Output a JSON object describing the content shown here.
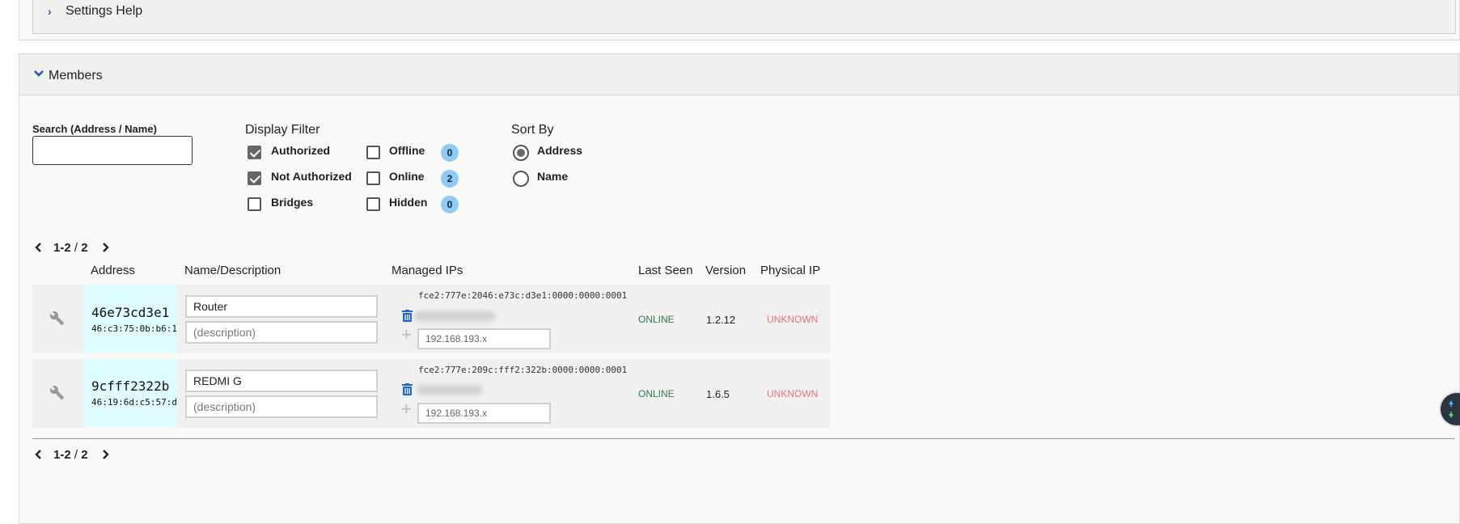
{
  "settings_help": {
    "title": "Settings Help"
  },
  "members": {
    "title": "Members",
    "search": {
      "label": "Search (Address / Name)",
      "value": ""
    },
    "display_filter": {
      "label": "Display Filter",
      "left_options": [
        {
          "label": "Authorized",
          "checked": true
        },
        {
          "label": "Not Authorized",
          "checked": true
        },
        {
          "label": "Bridges",
          "checked": false
        }
      ],
      "right_options": [
        {
          "label": "Offline",
          "checked": false,
          "count": "0"
        },
        {
          "label": "Online",
          "checked": false,
          "count": "2"
        },
        {
          "label": "Hidden",
          "checked": false,
          "count": "0"
        }
      ]
    },
    "sort_by": {
      "label": "Sort By",
      "options": [
        {
          "label": "Address",
          "selected": true
        },
        {
          "label": "Name",
          "selected": false
        }
      ]
    },
    "pager": {
      "range": "1-2",
      "separator": " / ",
      "total": "2"
    },
    "columns": {
      "address": "Address",
      "name": "Name/Description",
      "managed_ips": "Managed IPs",
      "last_seen": "Last Seen",
      "version": "Version",
      "physical_ip": "Physical IP"
    },
    "rows": [
      {
        "address": "46e73cd3e1",
        "mac": "46:c3:75:0b:b6:1",
        "name": "Router",
        "description_placeholder": "(description)",
        "ipv6": "fce2:777e:2046:e73c:d3e1:0000:0000:0001",
        "ip_placeholder": "192.168.193.x",
        "last_seen": "ONLINE",
        "version": "1.2.12",
        "physical_ip": "UNKNOWN"
      },
      {
        "address": "9cfff2322b",
        "mac": "46:19:6d:c5:57:d",
        "name": "REDMI G",
        "description_placeholder": "(description)",
        "ipv6": "fce2:777e:209c:fff2:322b:0000:0000:0001",
        "ip_placeholder": "192.168.193.x",
        "last_seen": "ONLINE",
        "version": "1.6.5",
        "physical_ip": "UNKNOWN"
      }
    ]
  },
  "icons": {
    "chevron_right": "chevron-right-icon",
    "chevron_down": "chevron-down-icon",
    "wrench": "wrench-icon",
    "trash": "trash-icon",
    "plus": "plus-icon"
  },
  "colors": {
    "accent_blue": "#1f5fa8",
    "badge_blue": "#8ec8f5",
    "address_cell": "#dffcff",
    "online_green": "#2e7d4f",
    "unknown_red": "#e57373"
  }
}
